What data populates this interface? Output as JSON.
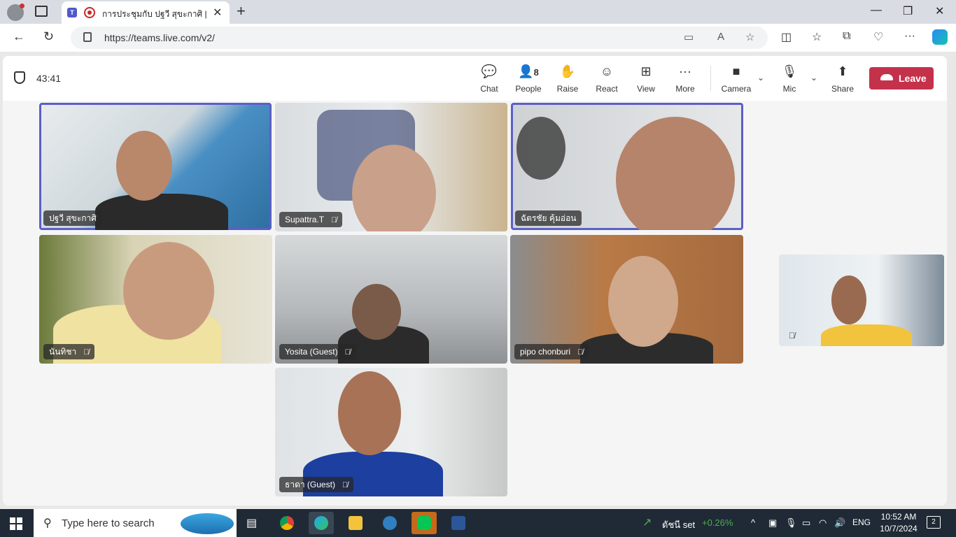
{
  "browser": {
    "tab_title": "การประชุมกับ ปฐวี สุขะกาศิ | Mic",
    "url": "https://teams.live.com/v2/",
    "new_tab_glyph": "+",
    "tab_close_glyph": "✕"
  },
  "meeting": {
    "timer": "43:41",
    "people_count": "8",
    "toolbar": {
      "chat": "Chat",
      "people": "People",
      "raise": "Raise",
      "react": "React",
      "view": "View",
      "more": "More",
      "camera": "Camera",
      "mic": "Mic",
      "share": "Share",
      "leave": "Leave"
    },
    "participants": [
      {
        "name": "ปฐวี สุขะกาศิ",
        "muted": false,
        "speaking": true
      },
      {
        "name": "Supattra.T",
        "muted": true,
        "speaking": false
      },
      {
        "name": "ฉัตรชัย คุ้มอ่อน",
        "muted": false,
        "speaking": true
      },
      {
        "name": "นันทิชา",
        "muted": true,
        "speaking": false
      },
      {
        "name": "Yosita (Guest)",
        "muted": true,
        "speaking": false
      },
      {
        "name": "pipo chonburi",
        "muted": true,
        "speaking": false
      },
      {
        "name": "ธาดา (Guest)",
        "muted": true,
        "speaking": false
      }
    ]
  },
  "taskbar": {
    "search_placeholder": "Type here to search",
    "stock_label": "ดัชนี set",
    "stock_change": "+0.26%",
    "language": "ENG",
    "time": "10:52 AM",
    "date": "10/7/2024",
    "notifications": "2"
  },
  "colors": {
    "accent": "#5b5fc7",
    "leave": "#c4314b",
    "stock_up": "#4caf50"
  }
}
